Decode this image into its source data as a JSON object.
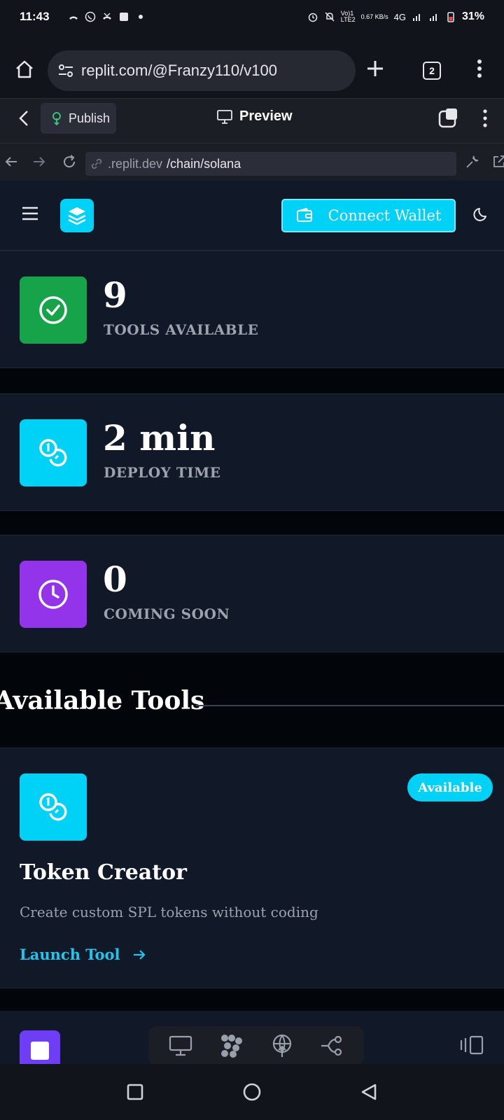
{
  "status_bar": {
    "time": "11:43",
    "battery": "31%",
    "network": "4G",
    "speed": "0.67 KB/s"
  },
  "browser": {
    "url": "replit.com/@Franzy110/v100",
    "tab_count": "2"
  },
  "replit": {
    "publish_label": "Publish",
    "preview_label": "Preview",
    "address_domain": ".replit.dev",
    "address_path": "/chain/solana"
  },
  "app": {
    "connect_wallet_label": "Connect Wallet",
    "stats": [
      {
        "value": "9",
        "label": "TOOLS AVAILABLE",
        "icon": "check-circle-icon",
        "color": "#16a34a"
      },
      {
        "value": "2 min",
        "label": "DEPLOY TIME",
        "icon": "coins-icon",
        "color": "#00d1f7"
      },
      {
        "value": "0",
        "label": "COMING SOON",
        "icon": "clock-icon",
        "color": "#9333ea"
      }
    ],
    "section_title": "Available Tools",
    "tools": [
      {
        "name": "Token Creator",
        "description": "Create custom SPL tokens without coding",
        "badge": "Available",
        "link_label": "Launch Tool",
        "icon": "coins-icon"
      }
    ]
  },
  "colors": {
    "accent": "#00d1f7",
    "card_bg": "#111827",
    "page_bg": "#020509",
    "success": "#16a34a",
    "purple": "#9333ea"
  }
}
